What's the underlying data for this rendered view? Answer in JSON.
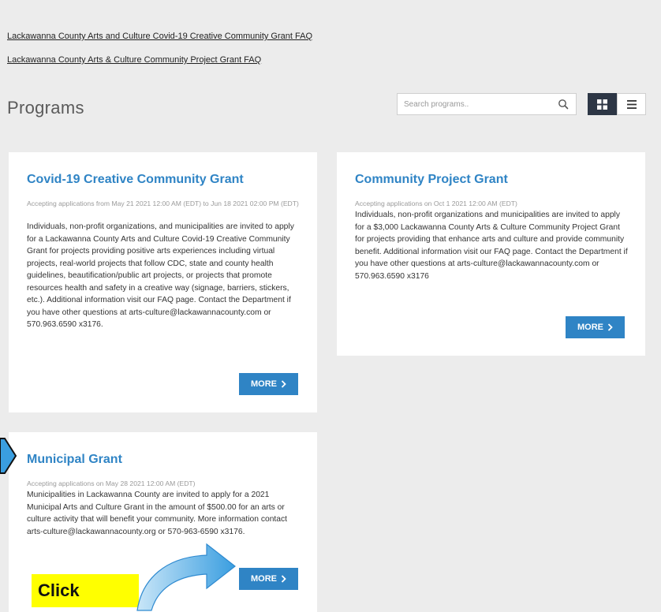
{
  "faq_links": [
    "Lackawanna County Arts and Culture Covid-19 Creative Community Grant FAQ",
    "Lackawanna County Arts & Culture Community Project Grant FAQ"
  ],
  "header": {
    "title": "Programs",
    "search_placeholder": "Search programs..",
    "search_icon": "search-icon",
    "grid_view_icon": "grid-view-icon",
    "list_view_icon": "list-view-icon"
  },
  "programs": [
    {
      "title": "Covid-19 Creative Community Grant",
      "dates": "Accepting applications from May 21 2021 12:00 AM (EDT) to Jun 18 2021 02:00 PM (EDT)",
      "description": "Individuals, non-profit organizations, and municipalities are invited to apply for a Lackawanna County Arts and Culture Covid-19 Creative Community Grant for projects providing positive arts experiences including virtual projects, real-world projects that follow CDC, state and county health guidelines, beautification/public art projects, or projects that promote resources health and safety in a creative way (signage, barriers, stickers, etc.). Additional information visit our FAQ page. Contact the Department if you have other questions at arts-culture@lackawannacounty.com or 570.963.6590 x3176.",
      "more_label": "MORE"
    },
    {
      "title": "Community Project Grant",
      "dates": "Accepting applications on Oct 1 2021 12:00 AM (EDT)",
      "description": "Individuals, non-profit organizations and municipalities are invited to apply for a $3,000 Lackawanna County Arts & Culture Community Project Grant for projects providing that enhance arts and culture and provide community benefit. Additional information visit our FAQ page. Contact the Department if you have other questions at arts-culture@lackawannacounty.com or 570.963.6590 x3176",
      "more_label": "MORE"
    },
    {
      "title": "Municipal Grant",
      "dates": "Accepting applications on May 28 2021 12:00 AM (EDT)",
      "description": "Municipalities in Lackawanna County are invited to apply for a 2021 Municipal Arts and Culture Grant in the amount of $500.00 for an arts or culture activity that will benefit your community. More information contact arts-culture@lackawannacounty.org or 570-963-6590 x3176.",
      "more_label": "MORE"
    }
  ],
  "annotation": {
    "click_label": "Click",
    "highlight_color": "#ffff00",
    "arrow_color": "#3a9ee0"
  },
  "colors": {
    "accent": "#2f84c5",
    "background": "#ececec",
    "dark_button": "#2d3645"
  }
}
